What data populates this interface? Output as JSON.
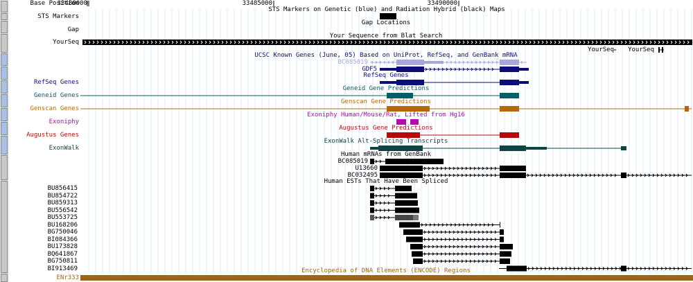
{
  "ruler": {
    "label": "Base Position",
    "ticks": [
      {
        "text": "33480000",
        "pos": 33480000
      },
      {
        "text": "33485000",
        "pos": 33485000
      },
      {
        "text": "33490000",
        "pos": 33490000
      }
    ]
  },
  "tracks": [
    {
      "id": "sts",
      "label": "STS Markers",
      "title": "STS Markers on Genetic (blue) and Radiation Hybrid (black) Maps",
      "color": "#000000"
    },
    {
      "id": "gap",
      "label": "Gap",
      "title": "Gap Locations",
      "color": "#000000"
    },
    {
      "id": "yourseq",
      "label": "YourSeq",
      "title": "Your Sequence from Blat Search",
      "color": "#000000",
      "extra_labels": [
        "YourSeq",
        "YourSeq"
      ]
    },
    {
      "id": "knowngenes",
      "label": "",
      "title": "UCSC Known Genes (June, 05) Based on UniProt, RefSeq, and GenBank mRNA",
      "color": "#0c0c78",
      "items": [
        "BC085019",
        "GDF5"
      ]
    },
    {
      "id": "refseq",
      "label": "RefSeq Genes",
      "title": "RefSeq Genes",
      "color": "#0c0c78"
    },
    {
      "id": "geneid",
      "label": "Geneid Genes",
      "title": "Geneid Gene Predictions",
      "color": "#005e67"
    },
    {
      "id": "genscan",
      "label": "Genscan Genes",
      "title": "Genscan Gene Predictions",
      "color": "#b4680a"
    },
    {
      "id": "exoniphy",
      "label": "Exoniphy",
      "title": "Exoniphy Human/Mouse/Rat, Lifted from Hg16",
      "color": "#b40ab4"
    },
    {
      "id": "augustus",
      "label": "Augustus Genes",
      "title": "Augustus Gene Predictions",
      "color": "#b40a0a"
    },
    {
      "id": "exonwalk",
      "label": "ExonWalk",
      "title": "ExonWalk Alt-Splicing Transcripts",
      "color": "#0f4445"
    },
    {
      "id": "mrna",
      "label": "",
      "title": "Human mRNAs from GenBank",
      "color": "#000000",
      "items": [
        "BC085019",
        "U13660",
        "BC032495"
      ]
    },
    {
      "id": "est",
      "label": "",
      "title": "Human ESTs That Have Been Spliced",
      "color": "#000000"
    },
    {
      "id": "encode",
      "label": "ENr333",
      "title": "Encyclopedia of DNA Elements (ENCODE) Regions",
      "color": "#9c6414"
    }
  ],
  "est_items": [
    "BU856415",
    "BU854722",
    "BU859313",
    "BU556542",
    "BU553725",
    "BU168206",
    "BG750046",
    "BI084366",
    "BU173828",
    "BQ641867",
    "BG750811",
    "BI913469"
  ],
  "colors": {
    "gutter": "#e8e8e8",
    "gutter_button": "#c8c8c8",
    "gutter_button_blue": "#a8c0e8",
    "grid": "#d8ecff",
    "known_light": "#a8a8d8"
  }
}
